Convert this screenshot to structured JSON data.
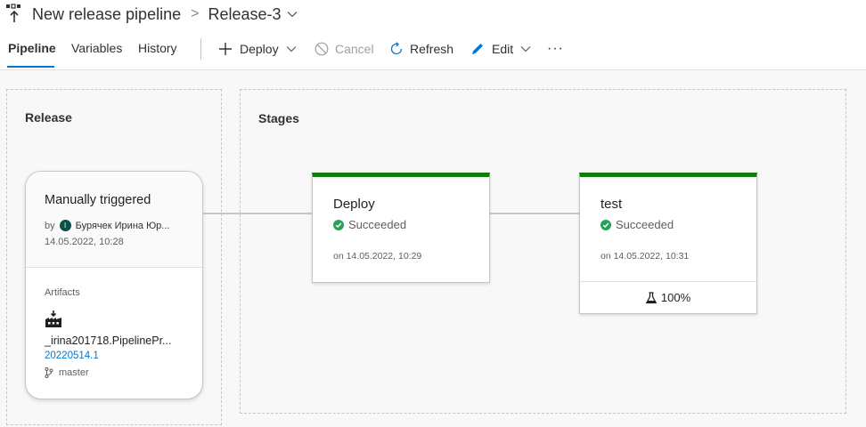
{
  "header": {
    "pipeline_title": "New release pipeline",
    "separator": ">",
    "release_name": "Release-3"
  },
  "tabs": [
    {
      "label": "Pipeline",
      "active": true
    },
    {
      "label": "Variables",
      "active": false
    },
    {
      "label": "History",
      "active": false
    }
  ],
  "toolbar": {
    "deploy_label": "Deploy",
    "cancel_label": "Cancel",
    "refresh_label": "Refresh",
    "edit_label": "Edit",
    "more_label": "···"
  },
  "release_panel": {
    "title": "Release",
    "trigger": "Manually triggered",
    "by_label": "by",
    "avatar_initial": "I",
    "user": "Бурячек Ирина Юр...",
    "date": "14.05.2022, 10:28",
    "artifacts_label": "Artifacts",
    "artifact_name": "_irina201718.PipelinePr...",
    "artifact_build": "20220514.1",
    "artifact_branch": "master"
  },
  "stages_panel": {
    "title": "Stages",
    "stages": [
      {
        "name": "Deploy",
        "status": "Succeeded",
        "time": "on 14.05.2022, 10:29"
      },
      {
        "name": "test",
        "status": "Succeeded",
        "time": "on 14.05.2022, 10:31",
        "tests": "100%"
      }
    ]
  },
  "colors": {
    "accent": "#0078d4",
    "success": "#107c10",
    "status_ok": "#2aa05a"
  }
}
